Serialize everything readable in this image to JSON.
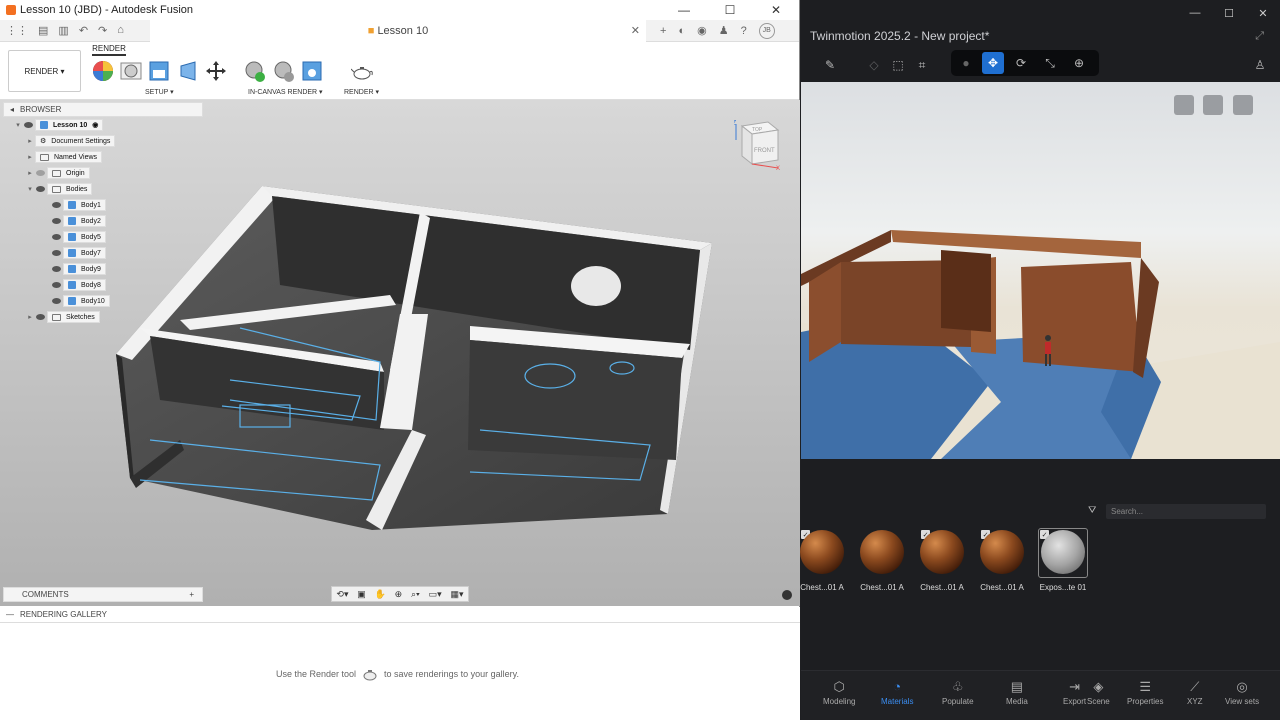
{
  "fusion": {
    "window_title": "Lesson 10 (JBD) - Autodesk Fusion",
    "win_buttons": [
      "—",
      "☐",
      "✕"
    ],
    "doc_tab": "Lesson 10",
    "doc_tab_close": "✕",
    "avatar": "JB",
    "workspace_button": "RENDER ▾",
    "ribbon_tab": "RENDER",
    "groups": [
      "SETUP ▾",
      "IN-CANVAS RENDER ▾",
      "RENDER ▾"
    ],
    "browser": {
      "title": "BROWSER",
      "root": "Lesson 10",
      "items": [
        {
          "label": "Document Settings"
        },
        {
          "label": "Named Views"
        },
        {
          "label": "Origin"
        },
        {
          "label": "Bodies"
        },
        {
          "label": "Body1"
        },
        {
          "label": "Body2"
        },
        {
          "label": "Body5"
        },
        {
          "label": "Body7"
        },
        {
          "label": "Body9"
        },
        {
          "label": "Body8"
        },
        {
          "label": "Body10"
        },
        {
          "label": "Sketches"
        }
      ]
    },
    "viewcube": {
      "top": "TOP",
      "front": "FRONT",
      "z": "Z",
      "x": "X"
    },
    "comments": {
      "title": "COMMENTS",
      "plus": "+"
    },
    "gallery": {
      "title": "RENDERING GALLERY",
      "msg_before": "Use the Render tool",
      "msg_after": "to save renderings to your gallery."
    }
  },
  "twinmotion": {
    "title": "Twinmotion 2025.2 - New project*",
    "search_placeholder": "Search...",
    "materials": [
      {
        "label": "Chest...01 A",
        "kind": "wood"
      },
      {
        "label": "Chest...01 A",
        "kind": "wood"
      },
      {
        "label": "Chest...01 A",
        "kind": "wood"
      },
      {
        "label": "Chest...01 A",
        "kind": "wood"
      },
      {
        "label": "Expos...te 01",
        "kind": "concrete"
      }
    ],
    "nav": [
      {
        "label": "Modeling",
        "icon": "cube-icon"
      },
      {
        "label": "Materials",
        "icon": "materials-icon",
        "active": true
      },
      {
        "label": "Populate",
        "icon": "populate-icon"
      },
      {
        "label": "Media",
        "icon": "media-icon"
      },
      {
        "label": "Export",
        "icon": "export-icon"
      },
      {
        "label": "Scene",
        "icon": "scene-icon"
      },
      {
        "label": "Properties",
        "icon": "properties-icon"
      },
      {
        "label": "XYZ",
        "icon": "xyz-icon"
      },
      {
        "label": "View sets",
        "icon": "viewsets-icon"
      }
    ],
    "accent": "#1f6fd1"
  }
}
